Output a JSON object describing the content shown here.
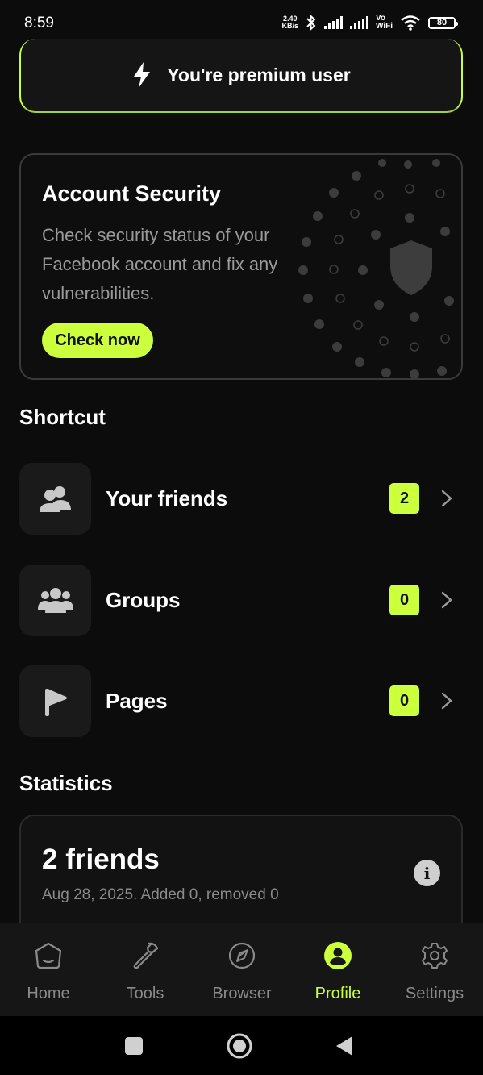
{
  "status_bar": {
    "time": "8:59",
    "net_speed_value": "2.40",
    "net_speed_unit": "KB/s",
    "vowifi_top": "Vo",
    "vowifi_bottom": "WiFi",
    "battery": "80"
  },
  "premium_banner": {
    "text": "You're premium user",
    "icon": "bolt-icon",
    "accent": "#ccff3c"
  },
  "account_security": {
    "title": "Account Security",
    "description": "Check security status of your Facebook account and fix any vulnerabilities.",
    "button_label": "Check now",
    "icon": "shield-icon"
  },
  "shortcut": {
    "heading": "Shortcut",
    "items": [
      {
        "label": "Your friends",
        "count": "2",
        "icon": "friends-icon"
      },
      {
        "label": "Groups",
        "count": "0",
        "icon": "groups-icon"
      },
      {
        "label": "Pages",
        "count": "0",
        "icon": "flag-icon"
      }
    ]
  },
  "statistics": {
    "heading": "Statistics",
    "title": "2 friends",
    "subtitle": "Aug 28, 2025. Added 0, removed 0",
    "info_glyph": "i"
  },
  "bottom_nav": {
    "items": [
      {
        "label": "Home",
        "icon": "home-icon",
        "active": false
      },
      {
        "label": "Tools",
        "icon": "wrench-icon",
        "active": false
      },
      {
        "label": "Browser",
        "icon": "compass-icon",
        "active": false
      },
      {
        "label": "Profile",
        "icon": "profile-icon",
        "active": true
      },
      {
        "label": "Settings",
        "icon": "gear-icon",
        "active": false
      }
    ]
  },
  "colors": {
    "background": "#0c0c0c",
    "accent": "#ccff3c",
    "muted_text": "#8a8a8a"
  }
}
